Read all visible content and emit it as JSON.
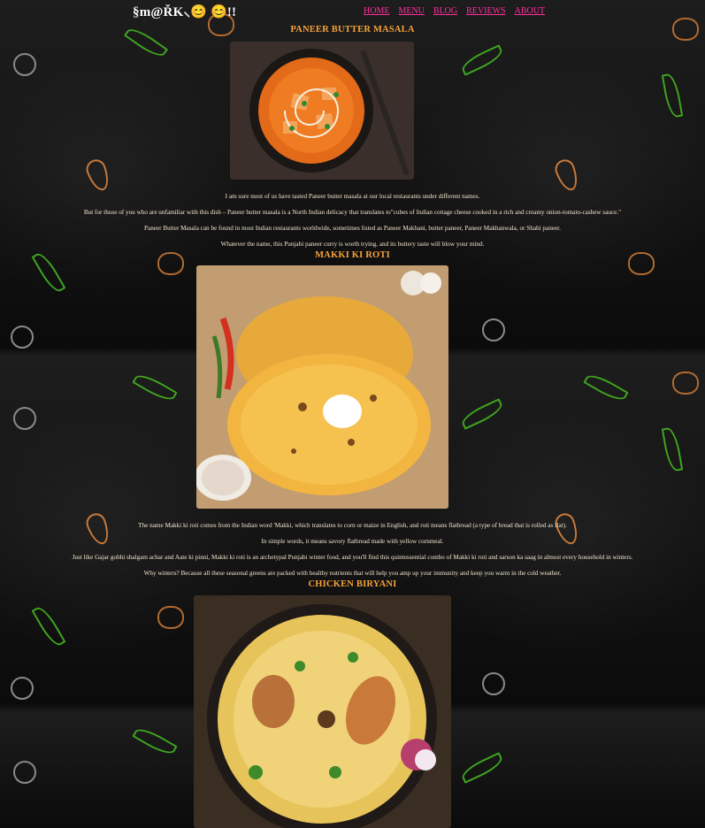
{
  "site": {
    "logo_text": "§m@ŘK⸜😊 😊!!"
  },
  "nav": {
    "items": [
      {
        "label": "HOME"
      },
      {
        "label": "MENU"
      },
      {
        "label": "BLOG"
      },
      {
        "label": "REVIEWS"
      },
      {
        "label": "ABOUT"
      }
    ]
  },
  "dishes": [
    {
      "title": "PANEER BUTTER MASALA",
      "paragraphs": [
        "I am sure most of us have tasted Paneer butter masala at our local restaurants under different names.",
        "But for those of you who are unfamiliar with this dish – Paneer butter masala is a North Indian delicacy that translates to\"cubes of Indian cottage cheese cooked in a rich and creamy onion-tomato-cashew sauce.\"",
        "Paneer Butter Masala can be found in most Indian restaurants worldwide, sometimes listed as Paneer Makhani, butter paneer, Paneer Makhanwala, or Shahi paneer.",
        "Whatever the name, this Punjabi paneer curry is worth trying, and its buttery taste will blow your mind."
      ]
    },
    {
      "title": "MAKKI KI ROTI",
      "paragraphs": [
        "The name Makki ki roti comes from the Indian word 'Makki, which translates to corn or maize in English, and roti means flatbread (a type of bread that is rolled as flat).",
        "In simple words, it means savory flatbread made with yellow cornmeal.",
        "Just like Gajar gobhi shalgam achar and Aate ki pinni, Makki ki roti is an archetypal Punjabi winter food, and you'll find this quintessential combo of Makki ki roti and sarson ka saag in almost every household in winters.",
        "Why winters? Because all these seasonal greens are packed with healthy nutrients that will help you amp up your immunity and keep you warm in the cold weather."
      ]
    },
    {
      "title": "CHICKEN BIRYANI",
      "paragraphs": []
    }
  ],
  "colors": {
    "nav_link": "#ff2f9e",
    "heading": "#f7a23a",
    "body_text": "#f1e6cf",
    "background": "#141414"
  }
}
